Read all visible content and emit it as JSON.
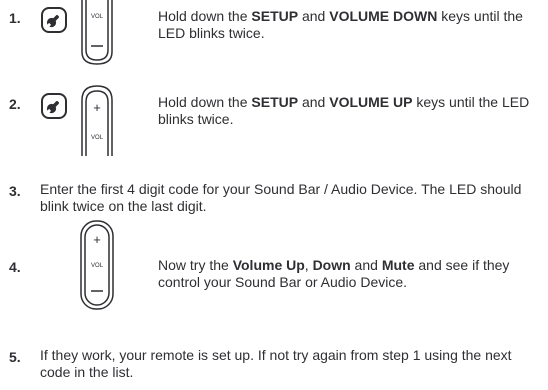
{
  "steps": [
    {
      "number": "1.",
      "parts": [
        "Hold down the ",
        "SETUP",
        " and ",
        "VOLUME DOWN",
        " keys until the LED blinks twice."
      ],
      "icons": [
        "setup-key-icon",
        "volume-down-key-icon"
      ]
    },
    {
      "number": "2.",
      "parts": [
        "Hold down the ",
        "SETUP",
        " and ",
        "VOLUME UP",
        " keys until the LED blinks twice."
      ],
      "icons": [
        "setup-key-icon",
        "volume-up-key-icon"
      ]
    },
    {
      "number": "3.",
      "text": "Enter the first 4 digit code for your Sound Bar / Audio Device. The LED should blink twice on the last digit."
    },
    {
      "number": "4.",
      "parts": [
        "Now try the ",
        "Volume Up",
        ", ",
        "Down",
        " and ",
        "Mute",
        " and see if they control your Sound Bar or Audio Device."
      ],
      "icons": [
        "volume-rocker-icon"
      ]
    },
    {
      "number": "5.",
      "text": "If they work, your remote is set up. If not try again from step 1 using the next code in the list."
    }
  ],
  "icon_labels": {
    "vol": "VOL",
    "plus": "+",
    "minus": "−"
  },
  "colors": {
    "text": "#2f2f33",
    "icon_stroke": "#2f2f33"
  }
}
